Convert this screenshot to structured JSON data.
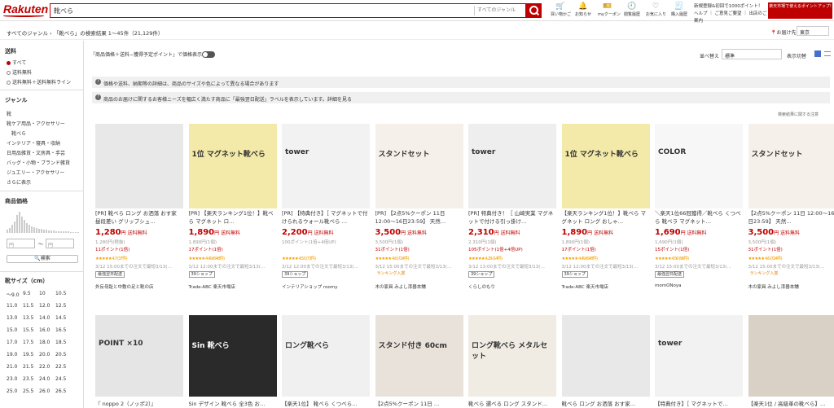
{
  "header": {
    "logo": "Rakuten",
    "search_value": "靴べら",
    "genre_select": "すべてのジャンル",
    "icons": [
      {
        "label": "買い物かご",
        "icon": "cart-icon"
      },
      {
        "label": "お知らせ",
        "icon": "bell-icon"
      },
      {
        "label": "myクーポン",
        "icon": "coupon-icon"
      },
      {
        "label": "閲覧履歴",
        "icon": "history-icon"
      },
      {
        "label": "お気に入り",
        "icon": "heart-icon"
      },
      {
        "label": "購入履歴",
        "icon": "receipt-icon"
      }
    ],
    "promo_line1": "新規登録&初回で1000ポイント！",
    "promo_line2": "ヘルプ ｜ ご意見ご要望 ｜ 出店のご案内",
    "promo_badge": "楽天市場で使えるポイントアップ!"
  },
  "breadcrumb": {
    "genre": "すべてのジャンル",
    "result": "「靴べら」の検索結果 1〜45件（21,129件）"
  },
  "delivery": {
    "label": "お届け先",
    "value": "東京"
  },
  "sidebar": {
    "shipping_title": "送料",
    "shipping_options": [
      "すべて",
      "送料無料",
      "送料無料＋送料無料ライン"
    ],
    "genre_title": "ジャンル",
    "genres": [
      "靴",
      "靴ケア用品・アクセサリー",
      "靴べら",
      "インテリア・寝具・収納",
      "日用品雑貨・文房具・手芸",
      "バッグ・小物・ブランド雑貨",
      "ジュエリー・アクセサリー",
      "さらに表示"
    ],
    "price_title": "商品価格",
    "price_min": "円",
    "price_max": "円",
    "price_separator": "〜",
    "price_button": "検索",
    "size_title": "靴サイズ（cm）",
    "sizes": [
      [
        "〜9.0",
        "9.5",
        "10",
        "10.5"
      ],
      [
        "11.0",
        "11.5",
        "12.0",
        "12.5"
      ],
      [
        "13.0",
        "13.5",
        "14.0",
        "14.5"
      ],
      [
        "15.0",
        "15.5",
        "16.0",
        "16.5"
      ],
      [
        "17.0",
        "17.5",
        "18.0",
        "18.5"
      ],
      [
        "19.0",
        "19.5",
        "20.0",
        "20.5"
      ],
      [
        "21.0",
        "21.5",
        "22.0",
        "22.5"
      ],
      [
        "23.0",
        "23.5",
        "24.0",
        "24.5"
      ],
      [
        "25.0",
        "25.5",
        "26.0",
        "26.5"
      ]
    ]
  },
  "toolbar": {
    "display_toggle": "「商品価格＋送料−獲得予定ポイント」で価格表示",
    "sort_label": "並べ替え",
    "sort_value": "標準",
    "view_label": "表示切替"
  },
  "notices": [
    "価格や送料、納期等の詳細は、商品のサイズや色によって異なる場合があります",
    "商品のお届けに関するお客様ニーズを幅広く満たす商品に「最強翌日配送」ラベルを表示しています。詳細を見る"
  ],
  "search_note": "検索結果に関する注意",
  "products": [
    {
      "title": "[PR] 靴べら ロング お洒落 おす家 昼段差い グリップシュ…",
      "price": "1,280",
      "unit": "円 送料無料",
      "sub": "1,280円(税抜)",
      "point": "11ポイント(1倍)",
      "rating": "★★★★★ 4.7 (37件)",
      "deadline": "3/12 15:00までの注文で最短3/13(…",
      "badge": "最強翌日配送",
      "shop": "外反母趾と中敷の足と靴の店",
      "img_text": "",
      "img_color": "#e8e8e8"
    },
    {
      "title": "[PR] 【楽天ランキング1位！】靴べら マグネット ロ…",
      "price": "1,890",
      "unit": "円 送料無料",
      "sub": "1,890円(1個)",
      "point": "17ポイント(1倍)",
      "rating": "★★★★★ 4.49 (648件)",
      "deadline": "3/12 12:00までの注文で最短3/13(…",
      "badge": "39ショップ",
      "shop": "Trade-ABC 楽天市場店",
      "img_text": "1位 マグネット靴べら",
      "img_color": "#f3e9a8"
    },
    {
      "title": "[PR] 【特典付き】［ マグネットで付けられるウォール靴べら …",
      "price": "2,200",
      "unit": "円 送料無料",
      "sub": "100ポイント(1倍+4倍UP)",
      "point": "",
      "rating": "★★★★★ 4.53 (73件)",
      "deadline": "3/12 12:00までの注文で最短3/13(…",
      "badge": "39ショップ",
      "shop": "インテリアショップ roomy",
      "img_text": "tower",
      "img_color": "#f2f2f2"
    },
    {
      "title": "[PR] 【2点5%クーポン 11日 12:00〜16日23:59】 天然…",
      "price": "3,500",
      "unit": "円 送料無料",
      "sub": "3,500円(1個)",
      "point": "31ポイント(1倍)",
      "rating": "★★★★★ 4.6 (724件)",
      "deadline": "3/12 15:00までの注文で最短3/13(…",
      "badge": "ランキング入賞",
      "shop": "木の家具 みよし漆器本舗",
      "img_text": "スタンドセット",
      "img_color": "#f5f0ea"
    },
    {
      "title": "[PR] 特典付き！［ 山崎実業 マグネットで付ける引っ掛け…",
      "price": "2,310",
      "unit": "円 送料無料",
      "sub": "2,310円(1個)",
      "point": "105ポイント(1倍+4倍UP)",
      "rating": "★★★★★ 4.29 (14件)",
      "deadline": "3/12 13:00までの注文で最短3/13(…",
      "badge": "39ショップ",
      "shop": "くらしのもり",
      "img_text": "tower",
      "img_color": "#eeeeee"
    },
    {
      "title": "【楽天ランキング1位！】靴べら マグネット ロング おしゃ…",
      "price": "1,890",
      "unit": "円 送料無料",
      "sub": "1,890円(1個)",
      "point": "17ポイント(1倍)",
      "rating": "★★★★★ 4.49 (648件)",
      "deadline": "3/12 12:00までの注文で最短3/13(…",
      "badge": "39ショップ",
      "shop": "Trade-ABC 楽天市場店",
      "img_text": "1位 マグネット靴べら",
      "img_color": "#f3e9a8"
    },
    {
      "title": "＼楽天1位66冠獲得／靴べら くつべら 靴ベラ マグネット…",
      "price": "1,690",
      "unit": "円 送料無料",
      "sub": "1,690円(1個)",
      "point": "15ポイント(1倍)",
      "rating": "★★★★★ 4.56 (96件)",
      "deadline": "3/12 15:00までの注文で最短3/13(…",
      "badge": "最強翌日配送",
      "shop": "momONoya",
      "img_text": "COLOR",
      "img_color": "#f7f7f7"
    },
    {
      "title": "【2点5%クーポン 11日 12:00〜16日23:59】 天然…",
      "price": "3,500",
      "unit": "円 送料無料",
      "sub": "3,500円(1個)",
      "point": "31ポイント(1倍)",
      "rating": "★★★★★ 4.6 (724件)",
      "deadline": "3/12 15:00までの注文で最短3/13(…",
      "badge": "ランキング入賞",
      "shop": "木の家具 みよし漆器本舗",
      "img_text": "スタンドセット",
      "img_color": "#f5f0ea"
    }
  ],
  "products_row2": [
    {
      "title": "『 noppo 2（ノッポ2）』",
      "img_text": "POINT ×10",
      "img_color": "#e5e5e5"
    },
    {
      "title": "Sin デザイン 靴べら 全3色 お…",
      "img_text": "Sin 靴べら",
      "img_color": "#2a2a2a"
    },
    {
      "title": "【楽天1位】 靴べら くつべら…",
      "img_text": "ロング靴べら",
      "img_color": "#f0f0f0"
    },
    {
      "title": "【2点5%クーポン 11日 …",
      "img_text": "スタンド付き 60cm",
      "img_color": "#e9e2da"
    },
    {
      "title": "靴べら 選べる ロング スタンド…",
      "img_text": "ロング靴べら メタルセット",
      "img_color": "#f0ece4"
    },
    {
      "title": "靴べら ロング お洒落 おす家…",
      "img_text": "",
      "img_color": "#e8e8e8"
    },
    {
      "title": "【特典付き】［ マグネットで…",
      "img_text": "tower",
      "img_color": "#f2f2f2"
    },
    {
      "title": "【楽天1位 / 高級革の靴べら】…",
      "img_text": "",
      "img_color": "#d9d0c6"
    }
  ]
}
